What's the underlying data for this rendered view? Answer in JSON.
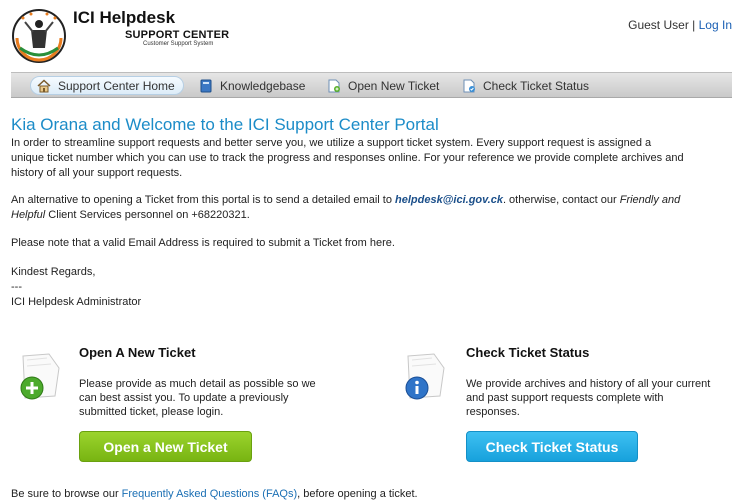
{
  "header": {
    "title": "ICI Helpdesk",
    "subtitle": "SUPPORT CENTER",
    "tagline": "Customer Support System",
    "user_label": "Guest User",
    "separator": "|",
    "login_label": "Log In"
  },
  "nav": {
    "items": [
      {
        "label": "Support Center Home",
        "icon": "home-icon"
      },
      {
        "label": "Knowledgebase",
        "icon": "book-icon"
      },
      {
        "label": "Open New Ticket",
        "icon": "new-ticket-icon"
      },
      {
        "label": "Check Ticket Status",
        "icon": "ticket-status-icon"
      }
    ]
  },
  "main": {
    "heading": "Kia Orana and Welcome to the ICI Support Center Portal",
    "intro_lines": [
      "In order to streamline support requests and better serve you, we utilize a support ticket system. Every support request is assigned a",
      "unique ticket number which you can use to track the progress and responses online. For your reference we provide complete archives and",
      "history of all your support requests."
    ],
    "alt_prefix": "An alternative to opening a Ticket from this portal is to send a detailed email to ",
    "alt_email": "helpdesk@ici.gov.ck",
    "alt_mid": ". otherwise, contact our ",
    "alt_friendly": "Friendly and",
    "alt_helpful": "Helpful",
    "alt_suffix": " Client Services personnel on +68220321.",
    "email_note": "Please note that a valid Email Address is required to submit a Ticket from here.",
    "regards": "Kindest Regards,",
    "dashes": "---",
    "signature": "ICI Helpdesk Administrator"
  },
  "open_box": {
    "title": "Open A New Ticket",
    "lines": [
      "Please provide as much detail as possible so we",
      "can best assist you. To update a previously",
      "submitted ticket, please login."
    ],
    "button": "Open a New Ticket"
  },
  "check_box": {
    "title": "Check Ticket Status",
    "lines": [
      "We provide archives and history of all your current",
      "and past support requests complete with",
      "responses."
    ],
    "button": "Check Ticket Status"
  },
  "footer": {
    "prefix": "Be sure to browse our ",
    "link": "Frequently Asked Questions (FAQs)",
    "suffix": ", before opening a ticket."
  },
  "colors": {
    "accent_blue": "#1c8cc8",
    "green_button": "#86c21c",
    "blue_button": "#22aee6"
  }
}
